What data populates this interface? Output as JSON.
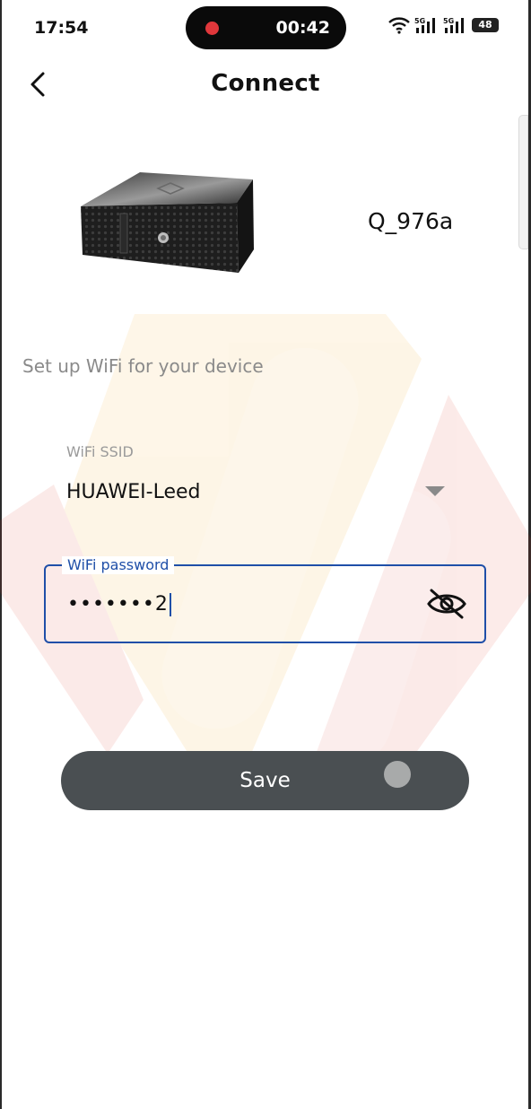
{
  "status_bar": {
    "time": "17:54",
    "recording_timer": "00:42",
    "battery": "48",
    "icons": [
      "wifi-icon",
      "signal-5g-icon",
      "signal-5g-icon",
      "battery-icon"
    ]
  },
  "header": {
    "back_icon": "chevron-left-icon",
    "title": "Connect"
  },
  "device": {
    "name": "Q_976a"
  },
  "setup_label": "Set up WiFi for your device",
  "ssid": {
    "label": "WiFi SSID",
    "value": "HUAWEI-Leed"
  },
  "password": {
    "label": "WiFi password",
    "value": "•••••••2",
    "toggle_icon": "eye-off-icon"
  },
  "save_label": "Save",
  "colors": {
    "accent": "#1f4fa8",
    "button_bg": "#4a4f52",
    "record_red": "#e0373b"
  }
}
